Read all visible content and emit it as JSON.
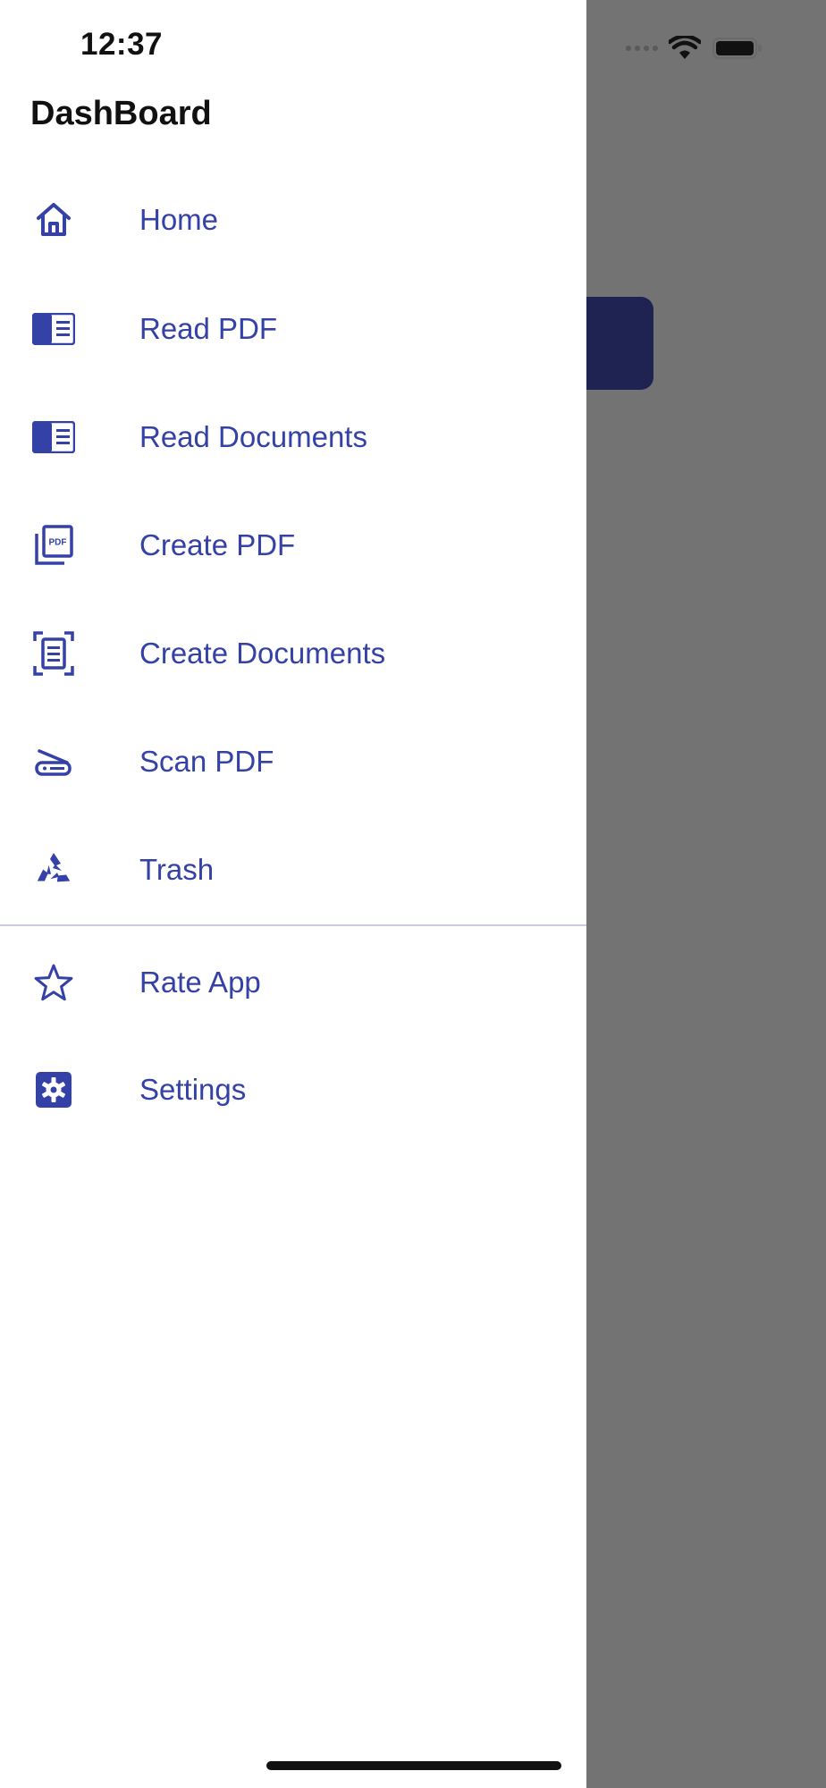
{
  "status_bar": {
    "time": "12:37"
  },
  "drawer": {
    "title": "DashBoard",
    "items": [
      {
        "label": "Home",
        "icon": "home-icon"
      },
      {
        "label": "Read PDF",
        "icon": "reader-icon"
      },
      {
        "label": "Read Documents",
        "icon": "reader-icon"
      },
      {
        "label": "Create PDF",
        "icon": "pdf-stack-icon"
      },
      {
        "label": "Create Documents",
        "icon": "document-scan-icon"
      },
      {
        "label": "Scan PDF",
        "icon": "scanner-icon"
      },
      {
        "label": "Trash",
        "icon": "recycle-icon"
      },
      {
        "label": "Rate App",
        "icon": "star-icon"
      },
      {
        "label": "Settings",
        "icon": "settings-icon"
      }
    ]
  },
  "colors": {
    "accent": "#3441a6",
    "overlay": "#737373",
    "card": "#1e2352"
  }
}
